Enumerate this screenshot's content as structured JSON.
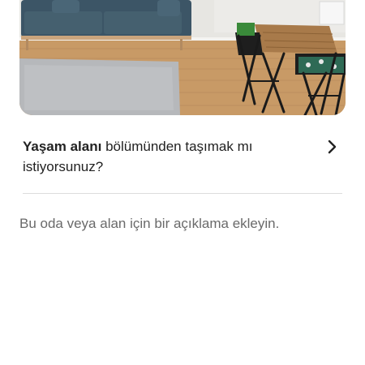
{
  "photo": {
    "alt": "",
    "colors": {
      "wall": "#e7e6e2",
      "floor": "#c89a66",
      "sofa": "#3c5566",
      "rug": "#b6b8bb"
    }
  },
  "move_prompt": {
    "room_name": "Yaşam alanı",
    "question_rest": " bölümünden taşımak mı istiyorsunuz?",
    "chevron": "chevron-right-icon"
  },
  "description": {
    "placeholder": "Bu oda veya alan için bir açıklama ekleyin."
  }
}
